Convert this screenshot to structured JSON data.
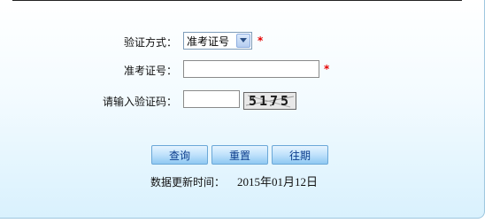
{
  "form": {
    "verify_method_label": "验证方式：",
    "verify_method_value": "准考证号",
    "ticket_label": "准考证号：",
    "ticket_value": "",
    "captcha_label": "请输入验证码：",
    "captcha_value": "",
    "captcha_text": "5175",
    "required_mark": "*"
  },
  "buttons": {
    "query": "查询",
    "reset": "重置",
    "history": "往期"
  },
  "footer": {
    "update_label": "数据更新时间：",
    "update_date": "2015年01月12日"
  }
}
